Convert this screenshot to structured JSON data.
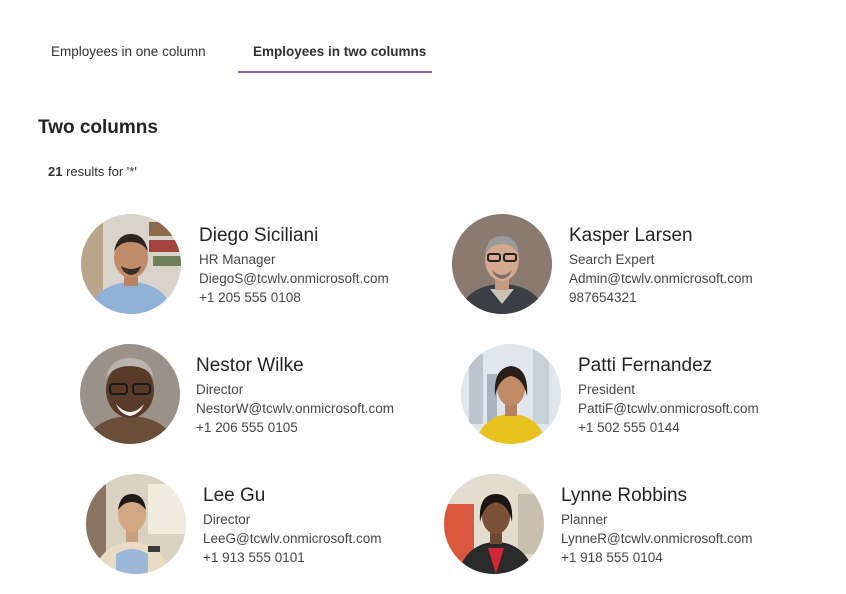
{
  "tabs": [
    {
      "label": "Employees in one column",
      "selected": false
    },
    {
      "label": "Employees in two columns",
      "selected": true
    }
  ],
  "accent_color": "#8764b8",
  "section_title": "Two columns",
  "results": {
    "count": "21",
    "text": "results for '*'"
  },
  "people": [
    {
      "name": "Diego Siciliani",
      "title": "HR Manager",
      "email": "DiegoS@tcwlv.onmicrosoft.com",
      "phone": "+1 205 555 0108"
    },
    {
      "name": "Kasper Larsen",
      "title": "Search Expert",
      "email": "Admin@tcwlv.onmicrosoft.com",
      "phone": "987654321"
    },
    {
      "name": "Nestor Wilke",
      "title": "Director",
      "email": "NestorW@tcwlv.onmicrosoft.com",
      "phone": "+1 206 555 0105"
    },
    {
      "name": "Patti Fernandez",
      "title": "President",
      "email": "PattiF@tcwlv.onmicrosoft.com",
      "phone": "+1 502 555 0144"
    },
    {
      "name": "Lee Gu",
      "title": "Director",
      "email": "LeeG@tcwlv.onmicrosoft.com",
      "phone": "+1 913 555 0101"
    },
    {
      "name": "Lynne Robbins",
      "title": "Planner",
      "email": "LynneR@tcwlv.onmicrosoft.com",
      "phone": "+1 918 555 0104"
    }
  ]
}
